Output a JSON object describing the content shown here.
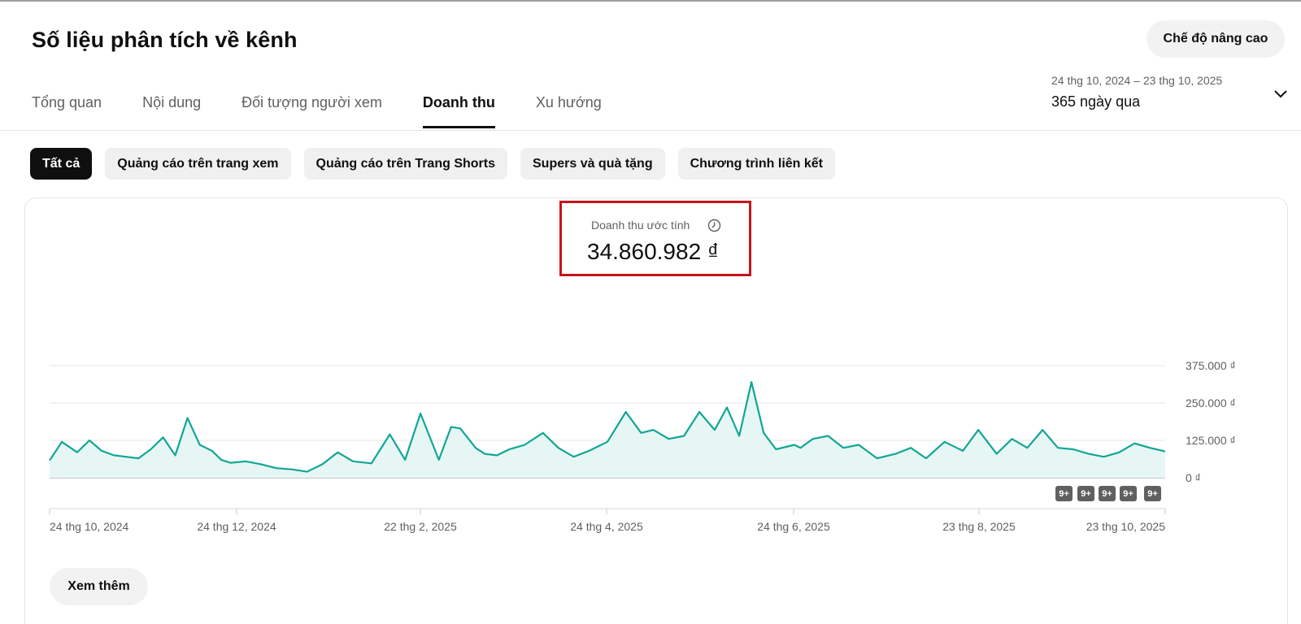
{
  "header": {
    "title": "Số liệu phân tích về kênh",
    "advanced_mode_label": "Chế độ nâng cao"
  },
  "tabs": [
    {
      "label": "Tổng quan"
    },
    {
      "label": "Nội dung"
    },
    {
      "label": "Đối tượng người xem"
    },
    {
      "label": "Doanh thu"
    },
    {
      "label": "Xu hướng"
    }
  ],
  "active_tab": "Doanh thu",
  "date_picker": {
    "range": "24 thg 10, 2024 – 23 thg 10, 2025",
    "period": "365 ngày qua",
    "icon": "chevron-down-icon"
  },
  "filters": [
    {
      "label": "Tất cả"
    },
    {
      "label": "Quảng cáo trên trang xem"
    },
    {
      "label": "Quảng cáo trên Trang Shorts"
    },
    {
      "label": "Supers và quà tặng"
    },
    {
      "label": "Chương trình liên kết"
    }
  ],
  "active_filter": "Tất cả",
  "metric": {
    "label": "Doanh thu ước tính",
    "value": "34.860.982 ₫",
    "icon": "clock-icon",
    "highlight_color": "#c8141b"
  },
  "badges": [
    {
      "label": "9+"
    },
    {
      "label": "9+"
    },
    {
      "label": "9+"
    },
    {
      "label": "9+"
    },
    {
      "label": "9+"
    }
  ],
  "see_more_label": "Xem thêm",
  "colors": {
    "line": "#12a694",
    "area": "#e6f6f4",
    "active_chip_bg": "#0f0f0f"
  },
  "chart_data": {
    "type": "area",
    "ylim": [
      0,
      375000
    ],
    "y_ticks": [
      0,
      125000,
      250000,
      375000
    ],
    "y_tick_labels": [
      "0 ₫",
      "125.000 ₫",
      "250.000 ₫",
      "375.000 ₫"
    ],
    "x_tick_labels": [
      "24 thg 10, 2024",
      "24 thg 12, 2024",
      "22 thg 2, 2025",
      "24 thg 4, 2025",
      "24 thg 6, 2025",
      "23 thg 8, 2025",
      "23 thg 10, 2025"
    ],
    "x_range": [
      "2024-10-24",
      "2025-10-23"
    ],
    "grid": true,
    "series": [
      {
        "x": [
          "2024-10-24",
          "2024-10-28",
          "2024-11-02",
          "2024-11-06",
          "2024-11-10",
          "2024-11-14",
          "2024-11-18",
          "2024-11-22",
          "2024-11-26",
          "2024-11-30",
          "2024-12-04",
          "2024-12-08",
          "2024-12-12",
          "2024-12-16",
          "2024-12-19",
          "2024-12-22",
          "2024-12-27",
          "2025-01-01",
          "2025-01-06",
          "2025-01-11",
          "2025-01-16",
          "2025-01-21",
          "2025-01-26",
          "2025-01-31",
          "2025-02-06",
          "2025-02-12",
          "2025-02-17",
          "2025-02-22",
          "2025-02-28",
          "2025-03-04",
          "2025-03-07",
          "2025-03-12",
          "2025-03-15",
          "2025-03-19",
          "2025-03-23",
          "2025-03-28",
          "2025-04-03",
          "2025-04-08",
          "2025-04-13",
          "2025-04-18",
          "2025-04-24",
          "2025-04-30",
          "2025-05-05",
          "2025-05-09",
          "2025-05-14",
          "2025-05-19",
          "2025-05-24",
          "2025-05-29",
          "2025-06-02",
          "2025-06-06",
          "2025-06-10",
          "2025-06-14",
          "2025-06-18",
          "2025-06-24",
          "2025-06-26",
          "2025-06-30",
          "2025-07-05",
          "2025-07-10",
          "2025-07-15",
          "2025-07-21",
          "2025-07-27",
          "2025-08-01",
          "2025-08-06",
          "2025-08-12",
          "2025-08-18",
          "2025-08-23",
          "2025-08-29",
          "2025-09-03",
          "2025-09-08",
          "2025-09-13",
          "2025-09-18",
          "2025-09-23",
          "2025-09-28",
          "2025-10-03",
          "2025-10-08",
          "2025-10-13",
          "2025-10-18",
          "2025-10-23"
        ],
        "values": [
          58000,
          120000,
          85000,
          125000,
          90000,
          75000,
          70000,
          65000,
          95000,
          135000,
          75000,
          200000,
          110000,
          90000,
          60000,
          50000,
          55000,
          45000,
          32000,
          28000,
          20000,
          45000,
          85000,
          55000,
          48000,
          145000,
          60000,
          215000,
          60000,
          170000,
          165000,
          100000,
          80000,
          75000,
          95000,
          110000,
          150000,
          100000,
          70000,
          90000,
          120000,
          220000,
          150000,
          160000,
          130000,
          140000,
          220000,
          160000,
          235000,
          140000,
          320000,
          150000,
          95000,
          110000,
          100000,
          130000,
          140000,
          100000,
          110000,
          65000,
          80000,
          100000,
          65000,
          120000,
          90000,
          160000,
          80000,
          130000,
          100000,
          160000,
          100000,
          95000,
          80000,
          70000,
          85000,
          115000,
          100000,
          88000
        ]
      }
    ]
  }
}
